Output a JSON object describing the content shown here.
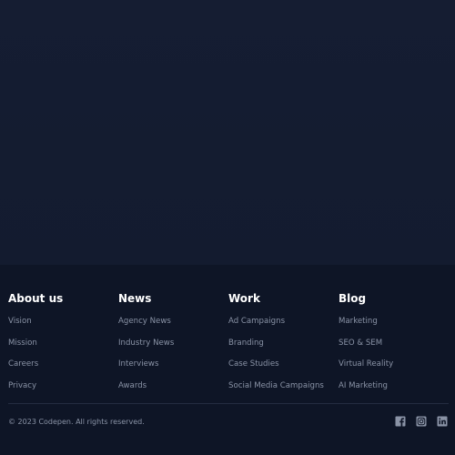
{
  "footer": {
    "columns": [
      {
        "heading": "About us",
        "links": [
          "Vision",
          "Mission",
          "Careers",
          "Privacy"
        ]
      },
      {
        "heading": "News",
        "links": [
          "Agency News",
          "Industry News",
          "Interviews",
          "Awards"
        ]
      },
      {
        "heading": "Work",
        "links": [
          "Ad Campaigns",
          "Branding",
          "Case Studies",
          "Social Media Campaigns"
        ]
      },
      {
        "heading": "Blog",
        "links": [
          "Marketing",
          "SEO & SEM",
          "Virtual Reality",
          "AI Marketing"
        ]
      }
    ],
    "copyright": "© 2023 Codepen. All rights reserved.",
    "socials": [
      "facebook-icon",
      "instagram-icon",
      "linkedin-icon"
    ],
    "colors": {
      "background": "#0e1526",
      "heading": "#ffffff",
      "link": "#8a93a6",
      "icon": "#8a93a6"
    }
  }
}
